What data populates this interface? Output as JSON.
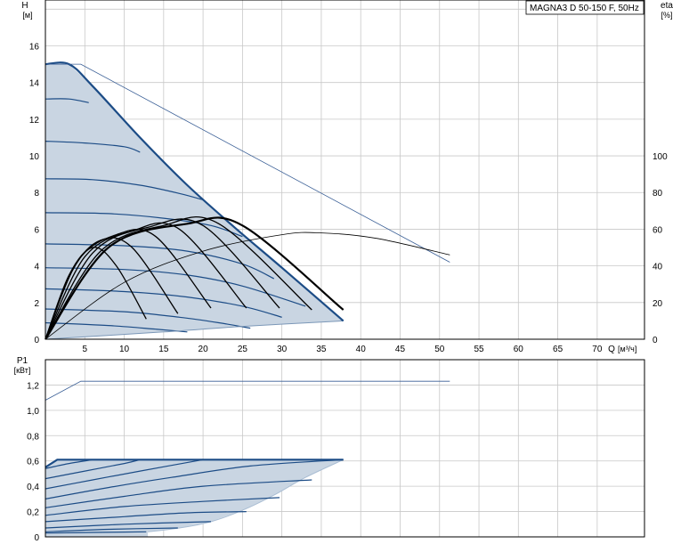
{
  "title": "MAGNA3 D 50-150 F, 50Hz",
  "chart_data": [
    {
      "type": "line",
      "id": "head-efficiency",
      "title": "MAGNA3 D 50-150 F, 50Hz",
      "xlabel": "Q",
      "xunit": "[м³/ч]",
      "ylabel": "H",
      "yunit": "[м]",
      "y2label": "eta",
      "y2unit": "[%]",
      "xlim": [
        0,
        76
      ],
      "ylim": [
        0,
        18.5
      ],
      "y2lim": [
        0,
        185
      ],
      "x_ticks": [
        0,
        5,
        10,
        15,
        20,
        25,
        30,
        35,
        40,
        45,
        50,
        55,
        60,
        65,
        70
      ],
      "y_ticks": [
        0,
        2,
        4,
        6,
        8,
        10,
        12,
        14,
        16
      ],
      "y2_ticks": [
        0,
        20,
        40,
        60,
        80,
        100
      ],
      "grid": true,
      "series": [
        {
          "role": "max-curve",
          "points": [
            [
              0,
              15
            ],
            [
              3,
              15
            ],
            [
              6,
              13.8
            ],
            [
              12,
              11
            ],
            [
              18,
              8.4
            ],
            [
              24,
              6.1
            ],
            [
              30,
              3.9
            ],
            [
              37.8,
              1
            ]
          ]
        },
        {
          "role": "speed-curves",
          "curves": [
            [
              [
                0,
                13.1
              ],
              [
                3,
                13.1
              ],
              [
                5.5,
                12.9
              ]
            ],
            [
              [
                0,
                10.8
              ],
              [
                5,
                10.7
              ],
              [
                10,
                10.5
              ],
              [
                12,
                10.2
              ]
            ],
            [
              [
                0,
                8.75
              ],
              [
                6,
                8.7
              ],
              [
                12,
                8.4
              ],
              [
                17,
                7.95
              ],
              [
                20,
                7.6
              ]
            ],
            [
              [
                0,
                6.9
              ],
              [
                8,
                6.85
              ],
              [
                15,
                6.6
              ],
              [
                21,
                6.2
              ],
              [
                25,
                5.6
              ]
            ],
            [
              [
                0,
                5.2
              ],
              [
                10,
                5.1
              ],
              [
                18,
                4.8
              ],
              [
                25,
                4.1
              ],
              [
                29,
                3.3
              ]
            ],
            [
              [
                0,
                3.9
              ],
              [
                10,
                3.8
              ],
              [
                18,
                3.5
              ],
              [
                25,
                2.9
              ],
              [
                33,
                1.8
              ]
            ],
            [
              [
                0,
                2.75
              ],
              [
                10,
                2.6
              ],
              [
                18,
                2.3
              ],
              [
                25,
                1.8
              ],
              [
                30,
                1.2
              ]
            ],
            [
              [
                0,
                1.65
              ],
              [
                10,
                1.5
              ],
              [
                17,
                1.2
              ],
              [
                22,
                0.9
              ],
              [
                26,
                0.6
              ]
            ],
            [
              [
                0,
                0.9
              ],
              [
                8,
                0.75
              ],
              [
                14,
                0.55
              ],
              [
                18,
                0.4
              ]
            ]
          ]
        },
        {
          "role": "min-curve",
          "points": [
            [
              0,
              0
            ],
            [
              15,
              0.4
            ],
            [
              25,
              0.7
            ],
            [
              37.8,
              1
            ]
          ]
        },
        {
          "role": "head-envelope-line",
          "points": [
            [
              0,
              15
            ],
            [
              4.5,
              15
            ],
            [
              51.3,
              4.2
            ]
          ]
        },
        {
          "role": "efficiency-envelope",
          "axis": "y2",
          "points": [
            [
              0,
              0
            ],
            [
              10,
              31
            ],
            [
              20,
              48
            ],
            [
              30,
              57
            ],
            [
              35,
              58
            ],
            [
              42,
              55
            ],
            [
              51.3,
              46
            ]
          ]
        },
        {
          "role": "efficiency-curves",
          "axis": "y2",
          "curves": [
            [
              [
                0,
                0
              ],
              [
                3,
                35
              ],
              [
                6,
                50
              ],
              [
                9,
                40
              ],
              [
                12.8,
                11
              ]
            ],
            [
              [
                0,
                0
              ],
              [
                3.5,
                38
              ],
              [
                7,
                54
              ],
              [
                11,
                50
              ],
              [
                16.8,
                14
              ]
            ],
            [
              [
                0,
                0
              ],
              [
                4,
                42
              ],
              [
                9,
                57
              ],
              [
                14,
                56
              ],
              [
                21,
                17
              ]
            ],
            [
              [
                0,
                0
              ],
              [
                5,
                45
              ],
              [
                11,
                59
              ],
              [
                17,
                60
              ],
              [
                25.5,
                17
              ]
            ],
            [
              [
                0,
                0
              ],
              [
                6,
                47
              ],
              [
                13,
                61
              ],
              [
                20,
                62
              ],
              [
                29.7,
                17
              ]
            ],
            [
              [
                0,
                0
              ],
              [
                7,
                48
              ],
              [
                15,
                62
              ],
              [
                22,
                63
              ],
              [
                33.8,
                16
              ]
            ],
            [
              [
                0,
                0
              ],
              [
                8,
                50
              ],
              [
                18,
                63
              ],
              [
                25,
                62
              ],
              [
                37.8,
                16
              ]
            ]
          ]
        }
      ]
    },
    {
      "type": "line",
      "id": "power",
      "ylabel": "P1",
      "yunit": "[кВт]",
      "ylim": [
        0,
        1.4
      ],
      "y_ticks": [
        0,
        0.2,
        0.4,
        0.6,
        0.8,
        1.0,
        1.2
      ],
      "y_tick_labels": [
        "0",
        "0,2",
        "0,4",
        "0,6",
        "0,8",
        "1,0",
        "1,2"
      ],
      "grid": true,
      "series": [
        {
          "role": "power-envelope-line",
          "points": [
            [
              0,
              1.08
            ],
            [
              4.5,
              1.23
            ],
            [
              51.3,
              1.23
            ]
          ]
        },
        {
          "role": "max-power",
          "points": [
            [
              0,
              0.55
            ],
            [
              1.5,
              0.61
            ],
            [
              37.8,
              0.61
            ]
          ]
        },
        {
          "role": "power-curves",
          "curves": [
            [
              [
                0,
                0.54
              ],
              [
                3,
                0.58
              ],
              [
                6,
                0.61
              ]
            ],
            [
              [
                0,
                0.46
              ],
              [
                5,
                0.52
              ],
              [
                10,
                0.58
              ],
              [
                12,
                0.61
              ]
            ],
            [
              [
                0,
                0.38
              ],
              [
                6,
                0.45
              ],
              [
                12,
                0.52
              ],
              [
                20,
                0.61
              ]
            ],
            [
              [
                0,
                0.3
              ],
              [
                8,
                0.39
              ],
              [
                16,
                0.47
              ],
              [
                26,
                0.56
              ],
              [
                37.8,
                0.61
              ]
            ],
            [
              [
                0,
                0.23
              ],
              [
                10,
                0.32
              ],
              [
                20,
                0.4
              ],
              [
                33.8,
                0.45
              ]
            ],
            [
              [
                0,
                0.17
              ],
              [
                10,
                0.24
              ],
              [
                20,
                0.28
              ],
              [
                29.7,
                0.31
              ]
            ],
            [
              [
                0,
                0.12
              ],
              [
                10,
                0.16
              ],
              [
                18,
                0.19
              ],
              [
                25.5,
                0.2
              ]
            ],
            [
              [
                0,
                0.07
              ],
              [
                10,
                0.1
              ],
              [
                21,
                0.12
              ]
            ],
            [
              [
                0,
                0.04
              ],
              [
                8,
                0.06
              ],
              [
                16.8,
                0.07
              ]
            ],
            [
              [
                0,
                0.03
              ],
              [
                6,
                0.035
              ],
              [
                12.8,
                0.04
              ]
            ]
          ]
        },
        {
          "role": "min-power",
          "points": [
            [
              0,
              0
            ],
            [
              37.8,
              0
            ]
          ]
        }
      ]
    }
  ]
}
